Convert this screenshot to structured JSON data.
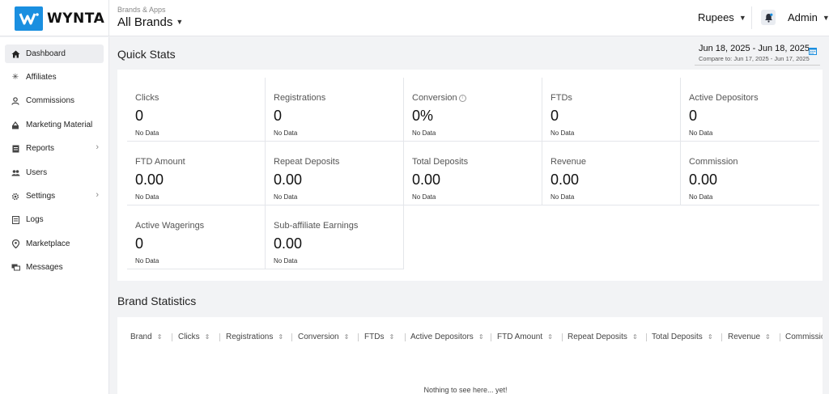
{
  "app": {
    "logo_text": "WYNTA",
    "brand_color": "#1a8fe0"
  },
  "header": {
    "brand_picker_label": "Brands & Apps",
    "brand_picker_value": "All Brands",
    "currency": "Rupees",
    "user": "Admin"
  },
  "sidebar": {
    "items": [
      {
        "label": "Dashboard",
        "icon": "home-icon",
        "active": true
      },
      {
        "label": "Affiliates",
        "icon": "affiliates-icon"
      },
      {
        "label": "Commissions",
        "icon": "commissions-icon"
      },
      {
        "label": "Marketing Material",
        "icon": "marketing-icon"
      },
      {
        "label": "Reports",
        "icon": "reports-icon",
        "has_submenu": true
      },
      {
        "label": "Users",
        "icon": "users-icon"
      },
      {
        "label": "Settings",
        "icon": "settings-icon",
        "has_submenu": true
      },
      {
        "label": "Logs",
        "icon": "logs-icon"
      },
      {
        "label": "Marketplace",
        "icon": "marketplace-icon"
      },
      {
        "label": "Messages",
        "icon": "messages-icon"
      }
    ]
  },
  "quick_stats": {
    "title": "Quick Stats",
    "date_range": "Jun 18, 2025 - Jun 18, 2025",
    "compare_text": "Compare to: Jun 17, 2025 - Jun 17, 2025",
    "no_data": "No Data",
    "stats": [
      {
        "label": "Clicks",
        "value": "0"
      },
      {
        "label": "Registrations",
        "value": "0"
      },
      {
        "label": "Conversion",
        "value": "0%"
      },
      {
        "label": "FTDs",
        "value": "0"
      },
      {
        "label": "Active Depositors",
        "value": "0"
      },
      {
        "label": "FTD Amount",
        "value": "0.00"
      },
      {
        "label": "Repeat Deposits",
        "value": "0.00"
      },
      {
        "label": "Total Deposits",
        "value": "0.00"
      },
      {
        "label": "Revenue",
        "value": "0.00"
      },
      {
        "label": "Commission",
        "value": "0.00"
      },
      {
        "label": "Active Wagerings",
        "value": "0"
      },
      {
        "label": "Sub-affiliate Earnings",
        "value": "0.00"
      }
    ]
  },
  "brand_statistics": {
    "title": "Brand Statistics",
    "columns": [
      "Brand",
      "Clicks",
      "Registrations",
      "Conversion",
      "FTDs",
      "Active Depositors",
      "FTD Amount",
      "Repeat Deposits",
      "Total Deposits",
      "Revenue",
      "Commissio"
    ],
    "empty_message": "Nothing to see here... yet!"
  }
}
